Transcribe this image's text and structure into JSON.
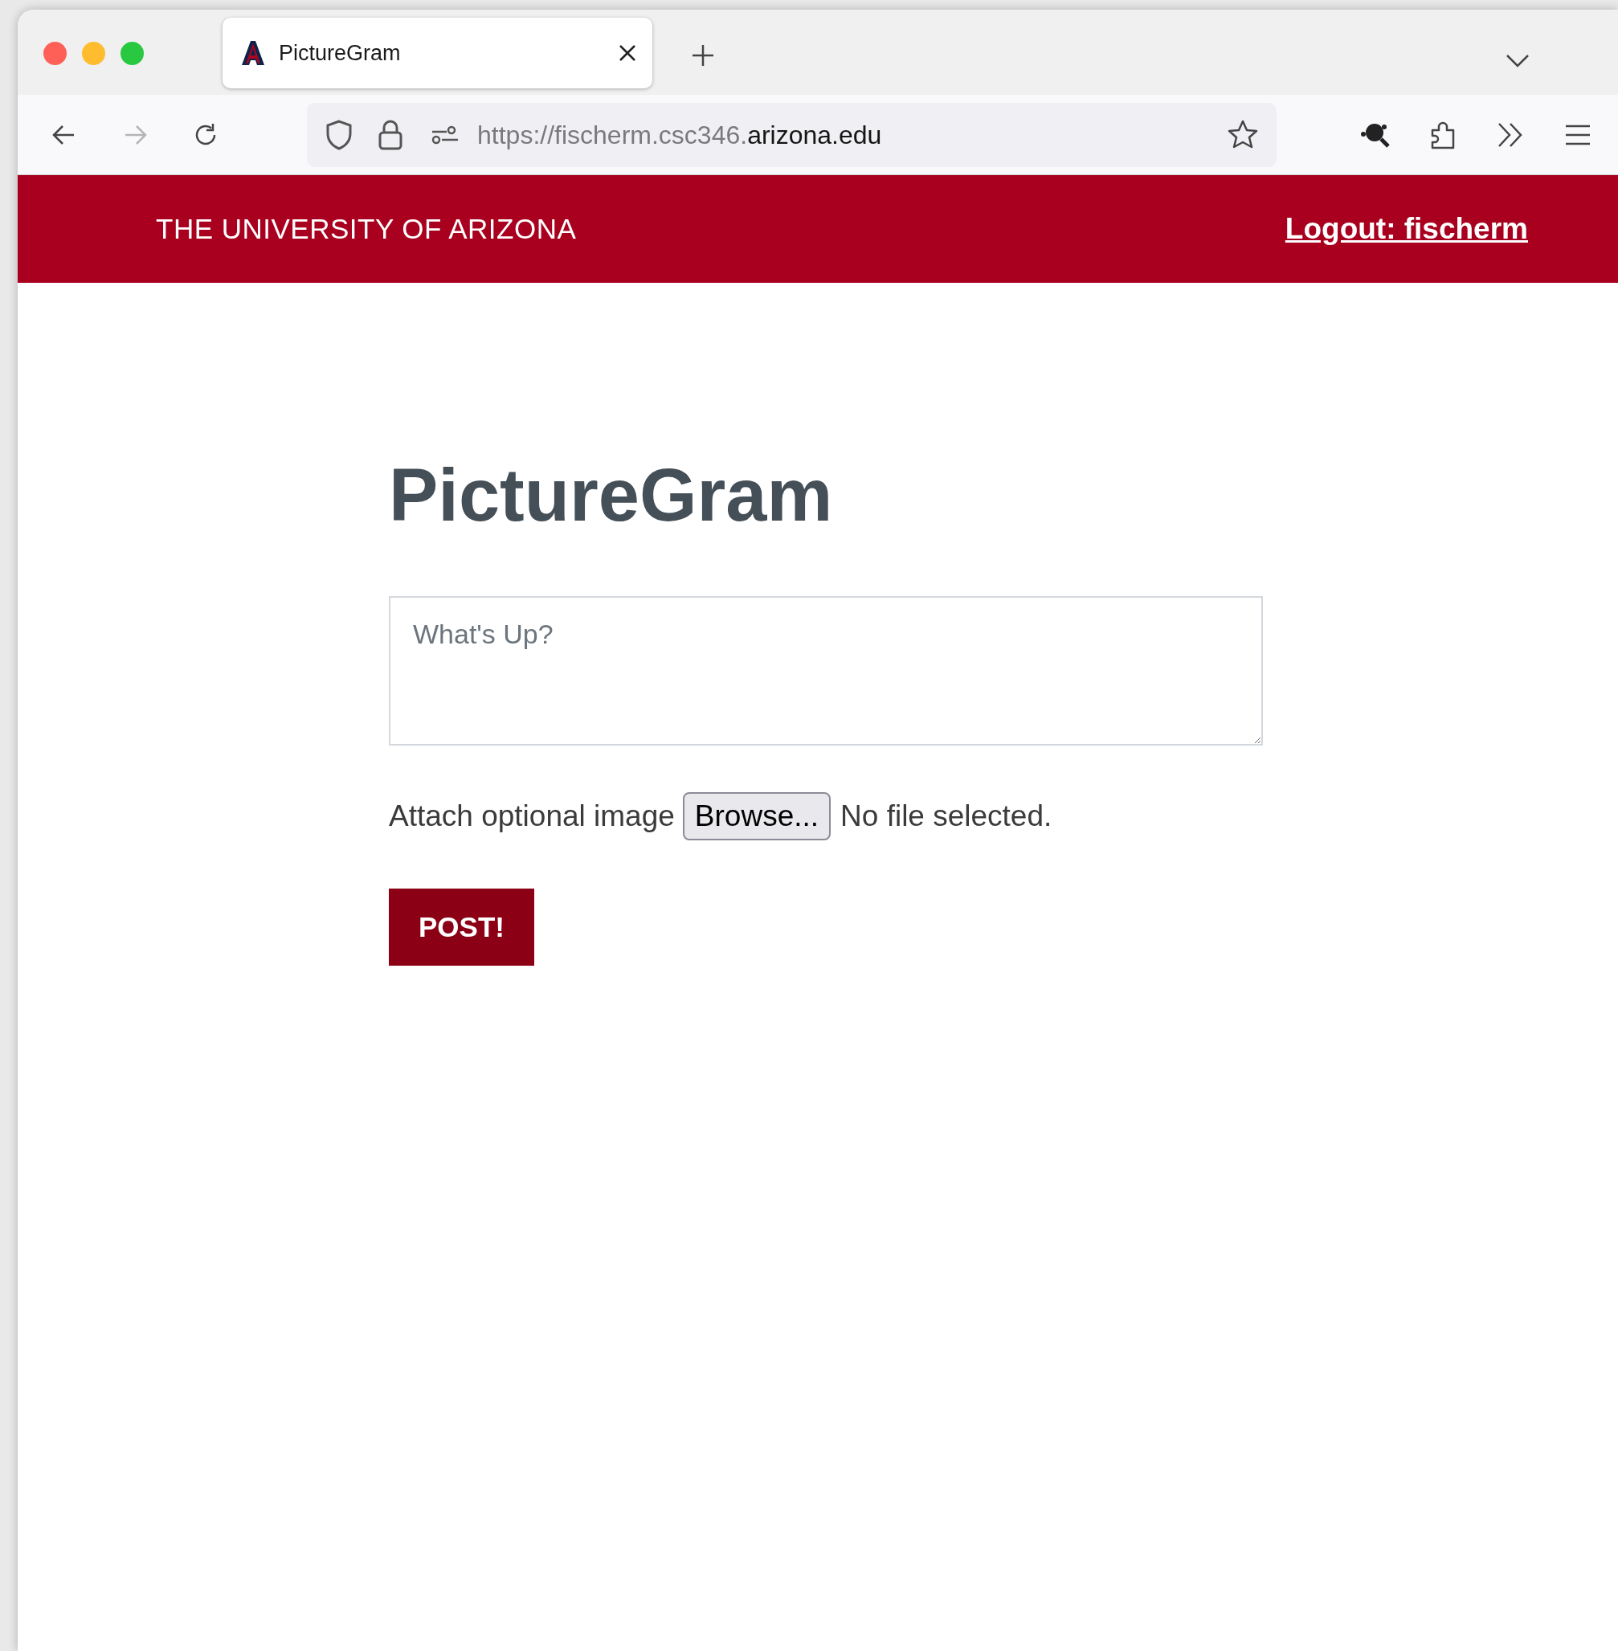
{
  "browser": {
    "tabs": [
      {
        "title": "PictureGram",
        "selected": true
      }
    ],
    "nav": [
      {
        "kind": "back",
        "disabled": false
      },
      {
        "kind": "forward",
        "disabled": true
      },
      {
        "kind": "reload",
        "disabled": false
      }
    ],
    "url": {
      "prefix": "https://fischerm.csc346.",
      "domain": "arizona.edu"
    }
  },
  "header": {
    "brand": "THE UNIVERSITY OF ARIZONA",
    "logout": "Logout: fischerm"
  },
  "page": {
    "title": "PictureGram",
    "post_field": {
      "placeholder": "What's Up?"
    },
    "attach": {
      "label": "Attach optional image",
      "button": "Browse...",
      "status": "No file selected."
    },
    "submit": "POST!"
  }
}
